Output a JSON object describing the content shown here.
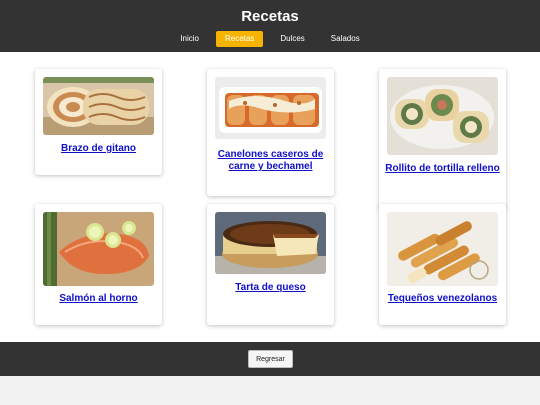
{
  "header": {
    "title": "Recetas",
    "nav": [
      {
        "label": "Inicio",
        "active": false
      },
      {
        "label": "Recetas",
        "active": true
      },
      {
        "label": "Dulces",
        "active": false
      },
      {
        "label": "Salados",
        "active": false
      }
    ]
  },
  "recipes": [
    {
      "title": "Brazo de gitano",
      "image": "sponge-roll-image"
    },
    {
      "title": "Canelones caseros de carne y bechamel",
      "image": "cannelloni-image"
    },
    {
      "title": "Rollito de tortilla relleno",
      "image": "tortilla-roll-image"
    },
    {
      "title": "Salmón al horno",
      "image": "baked-salmon-image"
    },
    {
      "title": "Tarta de queso",
      "image": "cheesecake-image"
    },
    {
      "title": "Tequeños venezolanos",
      "image": "tequenos-image"
    }
  ],
  "footer": {
    "back_label": "Regresar"
  },
  "colors": {
    "header_bg": "#333333",
    "active_tab": "#f5b400",
    "link": "#1010c8"
  }
}
